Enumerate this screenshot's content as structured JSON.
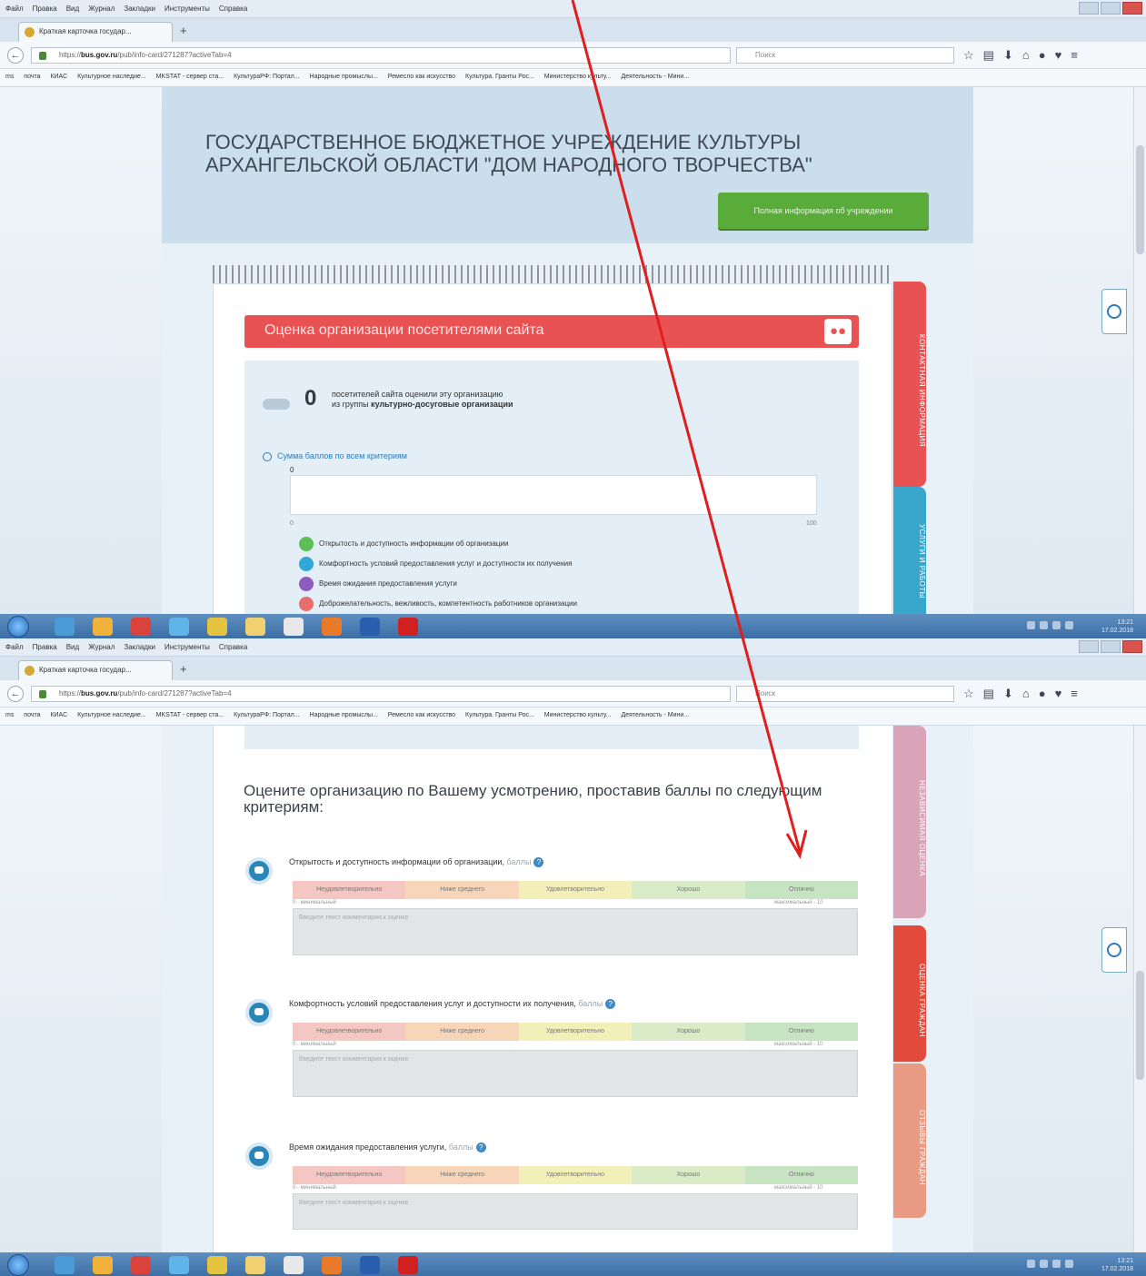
{
  "browser": {
    "menu": [
      "Файл",
      "Правка",
      "Вид",
      "Журнал",
      "Закладки",
      "Инструменты",
      "Справка"
    ],
    "tab_title": "Краткая карточка государ...",
    "new_tab": "+",
    "url_host": "bus.gov.ru",
    "url_rest": "/pub/info-card/271287?activeTab=4",
    "url_prefix": "https://",
    "search_placeholder": "Поиск",
    "bookmarks": [
      "ms",
      "почта",
      "КИАС",
      "Культурное наследие...",
      "MKSTAT - сервер ста...",
      "КультураРФ: Портал...",
      "Народные промыслы...",
      "Ремесло как искусство",
      "Культура. Гранты Рос...",
      "Министерство культу...",
      "Деятельность - Мини..."
    ]
  },
  "org": {
    "title_line1": "ГОСУДАРСТВЕННОЕ БЮДЖЕТНОЕ УЧРЕЖДЕНИЕ КУЛЬТУРЫ",
    "title_line2": "АРХАНГЕЛЬСКОЙ ОБЛАСТИ \"ДОМ НАРОДНОГО ТВОРЧЕСТВА\"",
    "info_button": "Полная информация об учреждении"
  },
  "rating": {
    "header": "Оценка организации посетителями сайта",
    "visitor_count": "0",
    "visitor_text1": "посетителей сайта оценили эту организацию",
    "visitor_text2_prefix": "из группы",
    "visitor_text2_group": "культурно-досуговые организации",
    "sum_link": "Сумма баллов по всем критериям",
    "bar_value": "0",
    "axis_min": "0",
    "axis_max": "100",
    "legend": [
      {
        "label": "Открытость и доступность информации об организации",
        "color": "#5cbf56"
      },
      {
        "label": "Комфортность условий предоставления услуг и доступности их получения",
        "color": "#2fa8d6"
      },
      {
        "label": "Время ожидания предоставления услуги",
        "color": "#8e5bbf"
      },
      {
        "label": "Доброжелательность, вежливость, компетентность работников организации",
        "color": "#e86d6d"
      }
    ]
  },
  "side_tabs_top": [
    {
      "label": "КОНТАКТНАЯ ИНФОРМАЦИЯ",
      "color": "#e95252"
    },
    {
      "label": "УСЛУГИ И РАБОТЫ",
      "color": "#39a6cc"
    }
  ],
  "side_tabs_bottom": [
    {
      "label": "НЕЗАВИСИМАЯ ОЦЕНКА",
      "color": "#d9a3b8"
    },
    {
      "label": "ОЦЕНКА ГРАЖДАН",
      "color": "#e24a3b"
    },
    {
      "label": "ОТЗЫВЫ ГРАЖДАН",
      "color": "#e99a82"
    }
  ],
  "evaluate": {
    "heading": "Оцените организацию по Вашему усмотрению, проставив баллы по следующим критериям:",
    "scale": [
      "Неудовлетворительно",
      "Ниже среднего",
      "Удовлетворительно",
      "Хорошо",
      "Отлично"
    ],
    "scale_min": "0 - минимальный",
    "scale_max": "максимальный - 10",
    "points_label": "баллы",
    "comment_placeholder": "Введите текст комментария к оценке",
    "criteria": [
      "Открытость и доступность информации об организации,",
      "Комфортность условий предоставления услуг и доступности их получения,",
      "Время ожидания предоставления услуги,"
    ]
  },
  "taskbar": {
    "time": "13:21",
    "date": "17.02.2018"
  },
  "colors": {
    "annotation_arrow": "#e21d1d",
    "accent_green": "#5aac3a",
    "accent_red": "#e95252"
  }
}
